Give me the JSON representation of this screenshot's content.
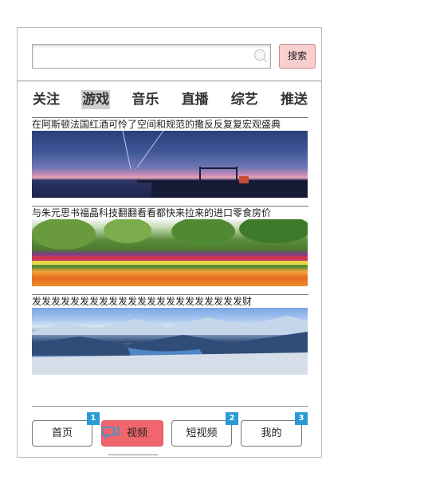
{
  "search": {
    "value": "",
    "placeholder": "",
    "button_label": "搜索"
  },
  "tabs": [
    {
      "label": "关注"
    },
    {
      "label": "游戏",
      "active": true
    },
    {
      "label": "音乐"
    },
    {
      "label": "直播"
    },
    {
      "label": "综艺"
    },
    {
      "label": "推送"
    }
  ],
  "feed": [
    {
      "title": "在阿斯顿法国红酒可怜了空间和规范的撒反反复复宏观盛典",
      "image": "sea-pier-sunset"
    },
    {
      "title": "与朱元思书福晶科技翻翻看看都快来拉来的进口零食房价",
      "image": "tulip-garden"
    },
    {
      "title": "发发发发发发发发发发发发发发发发发发发发发发财",
      "image": "snowy-valley"
    }
  ],
  "bottom_nav": [
    {
      "label": "首页",
      "badge": "1"
    },
    {
      "label": "视频",
      "active": true,
      "icon": "video-chat-icon"
    },
    {
      "label": "短视频",
      "badge": "2"
    },
    {
      "label": "我的",
      "badge": "3"
    }
  ],
  "colors": {
    "search_button_bg": "#f7cfcf",
    "active_tab_bg": "#cfcfcf",
    "active_nav_bg": "#f0666c",
    "badge_bg": "#2a9ad6"
  }
}
